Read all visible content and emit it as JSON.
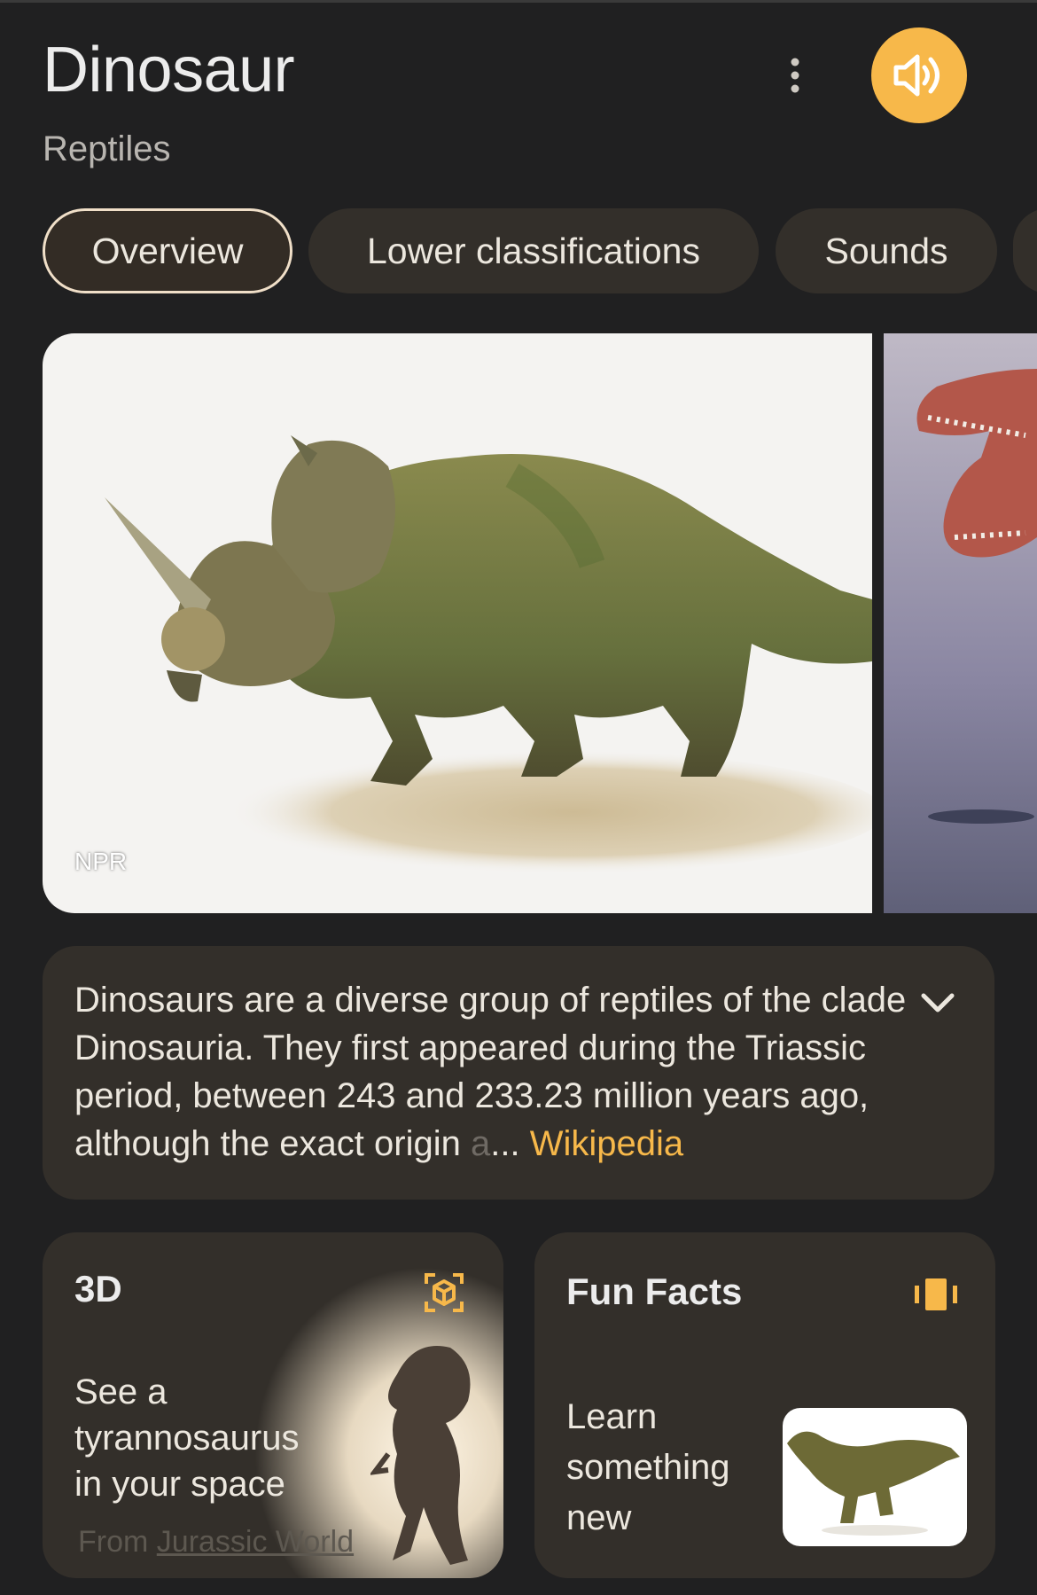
{
  "header": {
    "title": "Dinosaur",
    "subtitle": "Reptiles"
  },
  "tabs": [
    {
      "label": "Overview",
      "active": true
    },
    {
      "label": "Lower classifications",
      "active": false
    },
    {
      "label": "Sounds",
      "active": false
    }
  ],
  "images": {
    "main_credit": "NPR"
  },
  "description": {
    "text": "Dinosaurs are a diverse group of reptiles of the clade Dinosauria. They first appeared during the Triassic period, between 243 and 233.23 million years ago, although the exact origin ",
    "faded": "a",
    "ellipsis": "... ",
    "source": "Wikipedia"
  },
  "cards": {
    "three_d": {
      "title": "3D",
      "body": "See a tyrannosaurus in your space",
      "source_prefix": "From ",
      "source_link": "Jurassic World"
    },
    "fun_facts": {
      "title": "Fun Facts",
      "body": "Learn something new"
    }
  },
  "colors": {
    "background": "#202021",
    "card": "#332f2a",
    "accent": "#f7b84a"
  },
  "icons": {
    "more": "more-vert-icon",
    "sound": "volume-icon",
    "expand": "chevron-down-icon",
    "three_d": "3d-cube-icon",
    "fun_facts": "cards-stack-icon"
  }
}
